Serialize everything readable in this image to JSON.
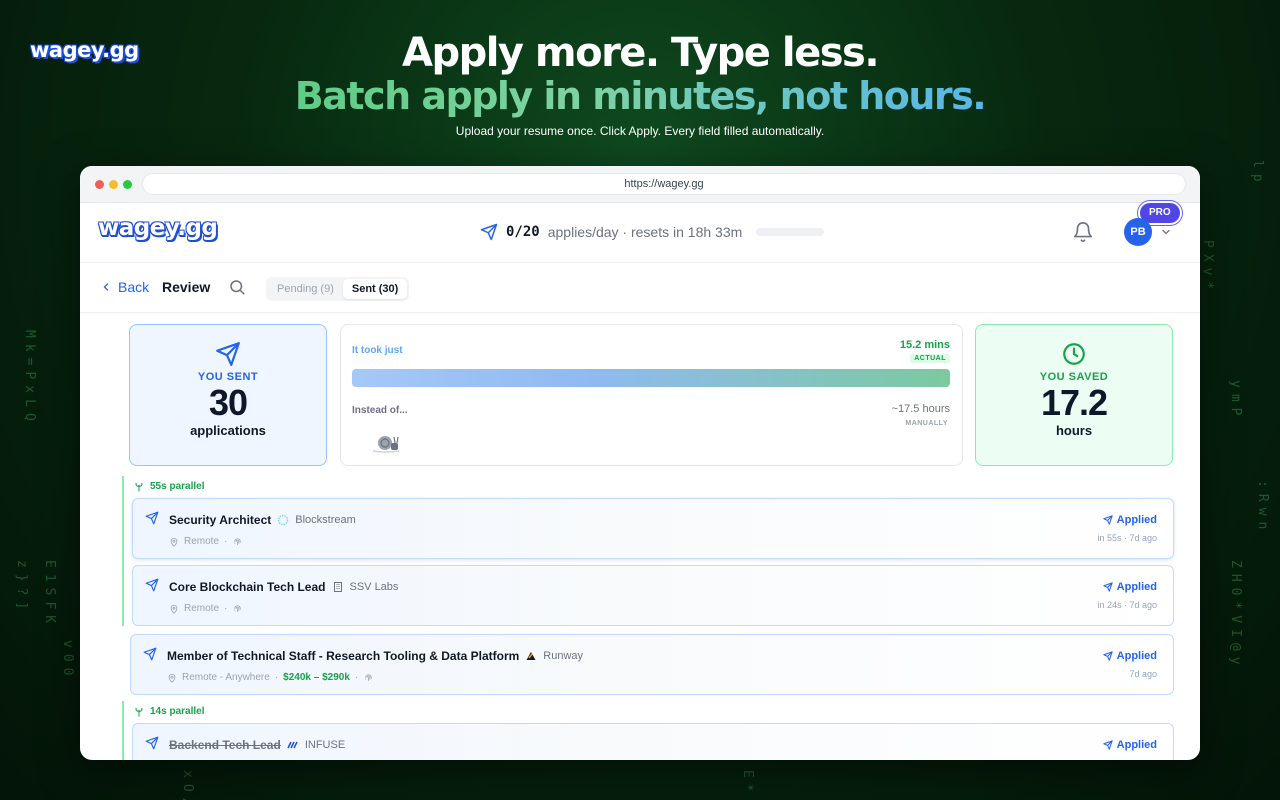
{
  "brand": {
    "logo_text": "wagey.gg"
  },
  "hero": {
    "title": "Apply more. Type less.",
    "subtitle": "Batch apply in minutes, not hours.",
    "tagline": "Upload your resume once. Click Apply. Every field filled automatically."
  },
  "browser": {
    "url": "https://wagey.gg"
  },
  "header": {
    "logo_text": "wagey.gg",
    "quota_count": "0/20",
    "quota_text": "applies/day · resets in 18h 33m",
    "avatar_initials": "PB",
    "pro_badge": "PRO"
  },
  "subnav": {
    "back_label": "Back",
    "title": "Review",
    "tabs": [
      {
        "label": "Pending (9)",
        "active": false
      },
      {
        "label": "Sent (30)",
        "active": true
      }
    ]
  },
  "stats": {
    "sent_label": "YOU SENT",
    "sent_value": "30",
    "sent_unit": "applications",
    "took_label": "It took just",
    "took_value": "15.2 mins",
    "actual_badge": "ACTUAL",
    "instead_label": "Instead of...",
    "instead_value": "~17.5 hours",
    "manual_badge": "MANUALLY",
    "saved_label": "YOU SAVED",
    "saved_value": "17.2",
    "saved_unit": "hours"
  },
  "groups": [
    {
      "label": "55s parallel",
      "jobs": [
        {
          "title": "Security Architect",
          "company": "Blockstream",
          "location": "Remote",
          "status": "Applied",
          "time": "in 55s · 7d ago"
        },
        {
          "title": "Core Blockchain Tech Lead",
          "company": "SSV Labs",
          "location": "Remote",
          "status": "Applied",
          "time": "in 24s · 7d ago"
        }
      ]
    },
    {
      "label": "14s parallel",
      "jobs": [
        {
          "title": "Backend Tech Lead",
          "company": "INFUSE",
          "status": "Applied"
        }
      ]
    }
  ],
  "loose_job": {
    "title": "Member of Technical Staff - Research Tooling & Data Platform",
    "company": "Runway",
    "location": "Remote - Anywhere",
    "salary": "$240k – $290k",
    "status": "Applied",
    "time": "7d ago"
  },
  "colors": {
    "accent": "#2563eb",
    "success": "#16a34a",
    "background": "#07280f"
  }
}
